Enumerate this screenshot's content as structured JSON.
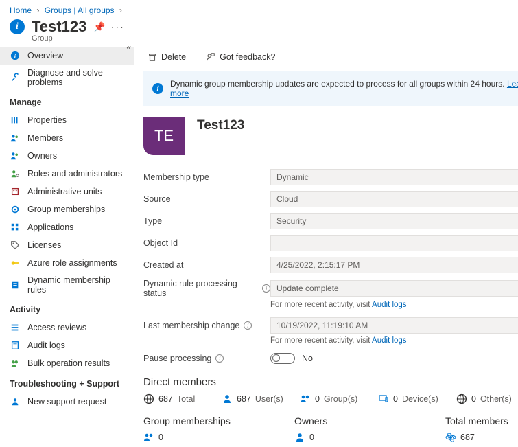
{
  "breadcrumb": {
    "home": "Home",
    "groups": "Groups | All groups"
  },
  "title": {
    "name": "Test123",
    "subtitle": "Group"
  },
  "toolbar": {
    "delete": "Delete",
    "feedback": "Got feedback?"
  },
  "banner": {
    "text": "Dynamic group membership updates are expected to process for all groups within 24 hours.",
    "link": "Learn more"
  },
  "sidebar": {
    "overview": "Overview",
    "diagnose": "Diagnose and solve problems",
    "section_manage": "Manage",
    "properties": "Properties",
    "members": "Members",
    "owners": "Owners",
    "roles": "Roles and administrators",
    "admin_units": "Administrative units",
    "group_memberships": "Group memberships",
    "applications": "Applications",
    "licenses": "Licenses",
    "azure_roles": "Azure role assignments",
    "dynamic_rules": "Dynamic membership rules",
    "section_activity": "Activity",
    "access_reviews": "Access reviews",
    "audit_logs": "Audit logs",
    "bulk_results": "Bulk operation results",
    "section_trouble": "Troubleshooting + Support",
    "support": "New support request"
  },
  "hero": {
    "initials": "TE",
    "name": "Test123"
  },
  "fields": {
    "membership_type": {
      "label": "Membership type",
      "value": "Dynamic"
    },
    "source": {
      "label": "Source",
      "value": "Cloud"
    },
    "type": {
      "label": "Type",
      "value": "Security"
    },
    "object_id": {
      "label": "Object Id",
      "value": ""
    },
    "created": {
      "label": "Created at",
      "value": "4/25/2022, 2:15:17 PM"
    },
    "dyn_status": {
      "label": "Dynamic rule processing status",
      "value": "Update complete"
    },
    "last_change": {
      "label": "Last membership change",
      "value": "10/19/2022, 11:19:10 AM"
    },
    "helper_pre": "For more recent activity, visit ",
    "helper_link": "Audit logs",
    "pause": {
      "label": "Pause processing",
      "value": "No"
    }
  },
  "direct": {
    "heading": "Direct members",
    "total": {
      "n": "687",
      "l": "Total"
    },
    "users": {
      "n": "687",
      "l": "User(s)"
    },
    "groups": {
      "n": "0",
      "l": "Group(s)"
    },
    "devices": {
      "n": "0",
      "l": "Device(s)"
    },
    "others": {
      "n": "0",
      "l": "Other(s)"
    }
  },
  "summary": {
    "gm": {
      "h": "Group memberships",
      "n": "0"
    },
    "owners": {
      "h": "Owners",
      "n": "0"
    },
    "total": {
      "h": "Total members",
      "n": "687"
    }
  }
}
